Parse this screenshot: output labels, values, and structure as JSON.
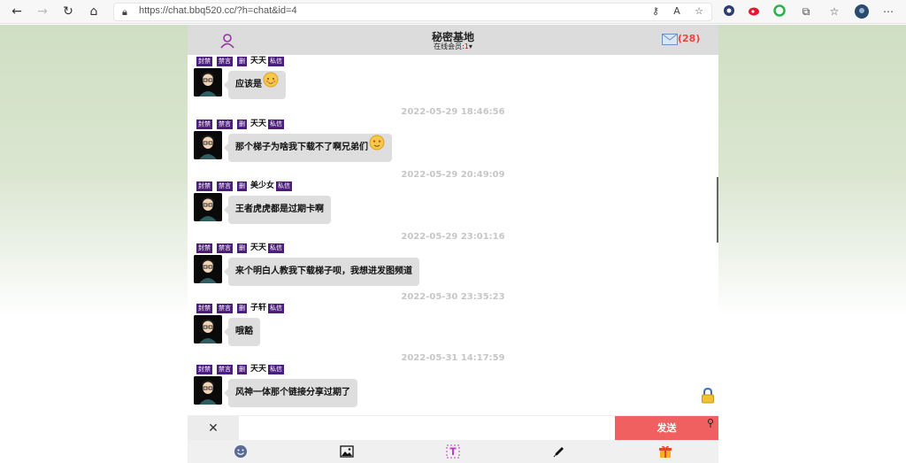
{
  "browser": {
    "url": "https://chat.bbq520.cc/?h=chat&id=4",
    "back_icon": "arrow-left-icon",
    "forward_icon": "arrow-right-icon",
    "refresh_icon": "refresh-icon",
    "home_icon": "home-icon"
  },
  "chat": {
    "title": "秘密基地",
    "online_label": "在线会员:",
    "online_count": "1",
    "mail_count": "(28)"
  },
  "tags": {
    "ban": "封禁",
    "mute": "禁言",
    "mark": "删",
    "private": "私信"
  },
  "messages": [
    {
      "user": "天天",
      "text": "应该是",
      "emoji": "blush-emoji"
    },
    {
      "timestamp": "2022-05-29 18:46:56",
      "user": "天天",
      "text": "那个梯子为啥我下载不了啊兄弟们",
      "emoji": "love-emoji"
    },
    {
      "timestamp": "2022-05-29 20:49:09",
      "user": "美少女",
      "text": "王者虎虎都是过期卡啊"
    },
    {
      "timestamp": "2022-05-29 23:01:16",
      "user": "天天",
      "text": "来个明白人教我下载梯子呗，我想进发图频道"
    },
    {
      "timestamp": "2022-05-30 23:35:23",
      "user": "子轩",
      "text": "哦豁"
    },
    {
      "timestamp": "2022-05-31 14:17:59",
      "user": "天天",
      "text": "风神一体那个链接分享过期了"
    }
  ],
  "input": {
    "close_label": "✕",
    "placeholder": "",
    "send_label": "发送"
  },
  "toolbar": [
    "smile-icon",
    "image-icon",
    "text-format-icon",
    "pen-icon",
    "gift-icon"
  ],
  "colors": {
    "tag_bg": "#4b1d7d",
    "send_bg": "#f06060",
    "header_bg": "#dcdcdc",
    "bubble_bg": "#dedede"
  }
}
